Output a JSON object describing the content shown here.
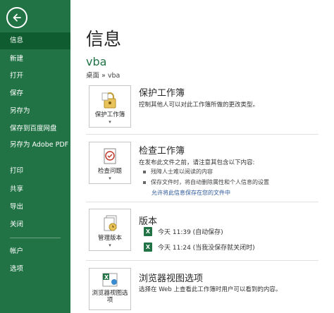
{
  "sidebar": {
    "back_icon": "arrow-left-icon",
    "items": [
      {
        "label": "信息"
      },
      {
        "label": "新建"
      },
      {
        "label": "打开"
      },
      {
        "label": "保存"
      },
      {
        "label": "另存为"
      },
      {
        "label": "保存到百度网盘"
      },
      {
        "label": "另存为 Adobe PDF"
      },
      {
        "label": "打印"
      },
      {
        "label": "共享"
      },
      {
        "label": "导出"
      },
      {
        "label": "关闭"
      },
      {
        "label": "帐户"
      },
      {
        "label": "选项"
      }
    ]
  },
  "main": {
    "title": "信息",
    "workbook_name": "vba",
    "breadcrumb": "桌面 » vba",
    "protect": {
      "button_label": "保护工作簿",
      "title": "保护工作簿",
      "desc": "控制其他人可以对此工作簿所做的更改类型。"
    },
    "inspect": {
      "button_label": "检查问题",
      "title": "检查工作簿",
      "desc": "在发布此文件之前，请注意其包含以下内容:",
      "bullets": [
        "残障人士难以阅读的内容",
        "保存文件时，将自动删除属性和个人信息的设置"
      ],
      "link": "允许将此信息保存在您的文件中"
    },
    "versions": {
      "button_label": "管理版本",
      "title": "版本",
      "items": [
        {
          "text": "今天 11:39 (自动保存)"
        },
        {
          "text": "今天 11:24 (当我没保存就关闭时)"
        }
      ]
    },
    "browser": {
      "button_label": "浏览器视图选项",
      "title": "浏览器视图选项",
      "desc": "选择在 Web 上查看此工作簿时用户可以看到的内容。"
    }
  },
  "colors": {
    "accent": "#217346",
    "active": "#0e5c2f",
    "link": "#2b579a"
  }
}
